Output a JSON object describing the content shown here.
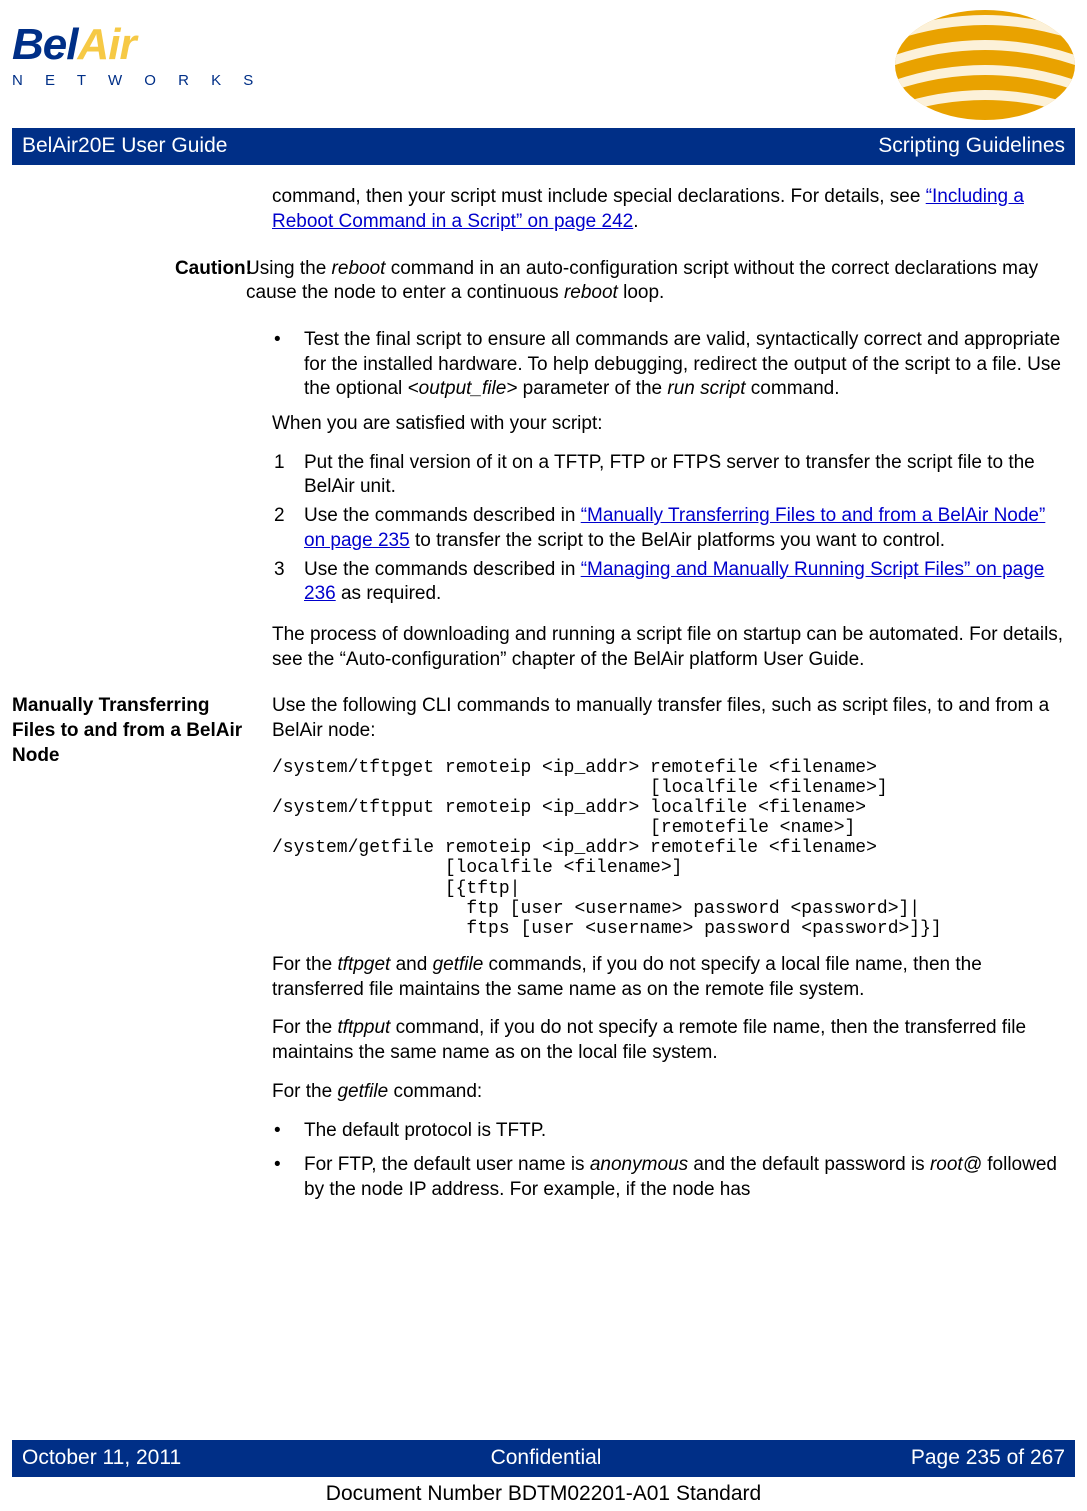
{
  "logo": {
    "brand1": "Bel",
    "brand2": "Air",
    "sub": "N E T W O R K S"
  },
  "banner": {
    "left": "BelAir20E User Guide",
    "right": "Scripting Guidelines"
  },
  "p1a": "command, then your script must include special declarations. For details, see ",
  "p1link": "“Including a Reboot Command in a Script” on page 242",
  "p1b": ".",
  "caution_label": "Caution!",
  "caution_a": "Using the ",
  "caution_b": " command in an auto-configuration script without the correct declarations may cause the node to enter a continuous ",
  "caution_c": " loop.",
  "reboot": "reboot",
  "bullet1a": "Test the final script to ensure all commands are valid, syntactically correct and appropriate for the installed hardware. To help debugging, redirect the output of the script to a file. Use the optional ",
  "outfile": "<output_file>",
  "bullet1b": " parameter of the ",
  "runscript": "run script",
  "bullet1c": " command.",
  "satisfied": "When you are satisfied with your script:",
  "n1": "1",
  "s1": "Put the final version of it on a TFTP, FTP or FTPS server to transfer the script file to the BelAir unit.",
  "n2": "2",
  "s2a": "Use the commands described in ",
  "s2link": "“Manually Transferring Files to and from a BelAir Node” on page 235",
  "s2b": " to transfer the script to the BelAir platforms you want to control.",
  "n3": "3",
  "s3a": "Use the commands described in ",
  "s3link": "“Managing and Manually Running Script Files” on page 236",
  "s3b": " as required.",
  "auto_para": "The process of downloading and running a script file on startup can be automated. For details, see the “Auto-configuration” chapter of the BelAir platform User Guide.",
  "section2_title": "Manually Transferring Files to and from a BelAir Node",
  "section2_intro": "Use the following CLI commands to manually transfer files, such as script files, to and from a BelAir node:",
  "cli": "/system/tftpget remoteip <ip_addr> remotefile <filename>\n                                   [localfile <filename>]\n/system/tftpput remoteip <ip_addr> localfile <filename>\n                                   [remotefile <name>]\n/system/getfile remoteip <ip_addr> remotefile <filename>\n                [localfile <filename>]\n                [{tftp|\n                  ftp [user <username> password <password>]|\n                  ftps [user <username> password <password>]}]",
  "p_get_a": "For the ",
  "tftpget": "tftpget",
  "p_get_b": " and ",
  "getfile": "getfile",
  "p_get_c": " commands, if you do not specify a local file name, then the transferred file maintains the same name as on the remote file system.",
  "p_put_a": "For the ",
  "tftpput": "tftpput",
  "p_put_b": " command, if you do not specify a remote file name, then the transferred file maintains the same name as on the local file system.",
  "p_getfile_hdr_a": "For the ",
  "p_getfile_hdr_b": " command:",
  "gb1": "The default protocol is TFTP.",
  "gb2a": "For FTP, the default user name is ",
  "anonymous": "anonymous",
  "gb2b": " and the default password is ",
  "rootat": "root@",
  "gb2c": " followed by the node IP address. For example, if the node has",
  "footer": {
    "date": "October 11, 2011",
    "conf": "Confidential",
    "page": "Page 235 of 267"
  },
  "docnum": "Document Number BDTM02201-A01 Standard",
  "bullet": "•"
}
